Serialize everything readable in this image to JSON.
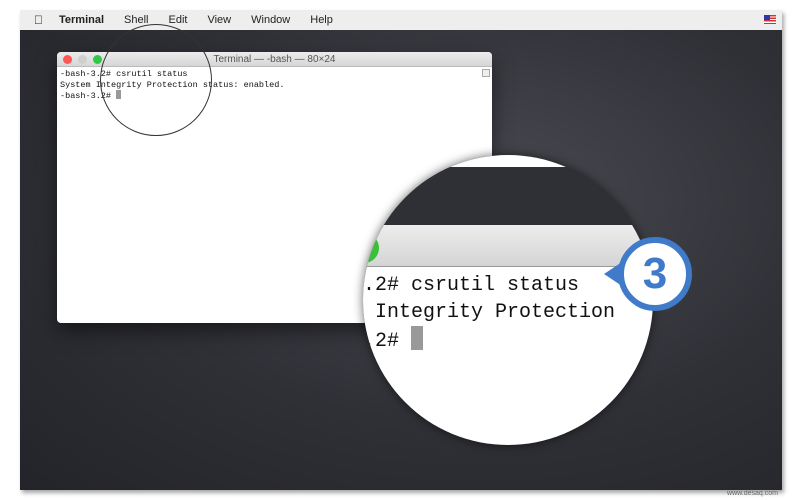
{
  "menubar": {
    "items": [
      "Terminal",
      "Shell",
      "Edit",
      "View",
      "Window",
      "Help"
    ]
  },
  "terminal": {
    "title": "Terminal — -bash — 80×24",
    "lines": [
      "-bash-3.2# csrutil status",
      "System Integrity Protection status: enabled.",
      "-bash-3.2# "
    ]
  },
  "magnifier": {
    "lines": [
      ".2# csrutil status",
      " Integrity Protection",
      ".2# "
    ]
  },
  "callout": {
    "step": "3",
    "color": "#3f7bc8"
  },
  "watermark": "www.desaq.com"
}
